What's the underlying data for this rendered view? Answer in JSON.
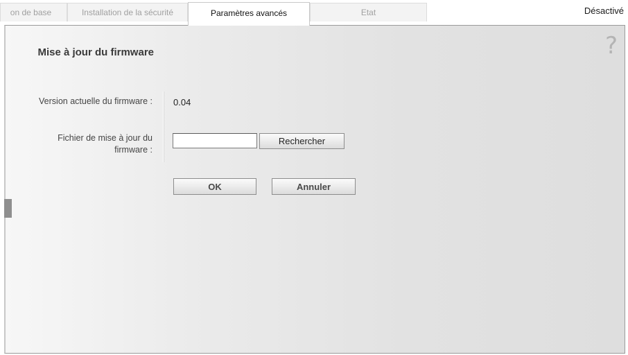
{
  "tabs": {
    "base": "on de base",
    "security": "Installation de la sécurité",
    "advanced": "Paramètres avancés",
    "state": "Etat"
  },
  "status": "Désactivé",
  "panel": {
    "help_symbol": "?",
    "section_title": "Mise à jour du firmware",
    "current_version_label": "Version actuelle du firmware :",
    "current_version_value": "0.04",
    "update_file_label": "Fichier de mise à jour du firmware :",
    "update_file_value": "",
    "browse_label": "Rechercher",
    "ok_label": "OK",
    "cancel_label": "Annuler"
  }
}
